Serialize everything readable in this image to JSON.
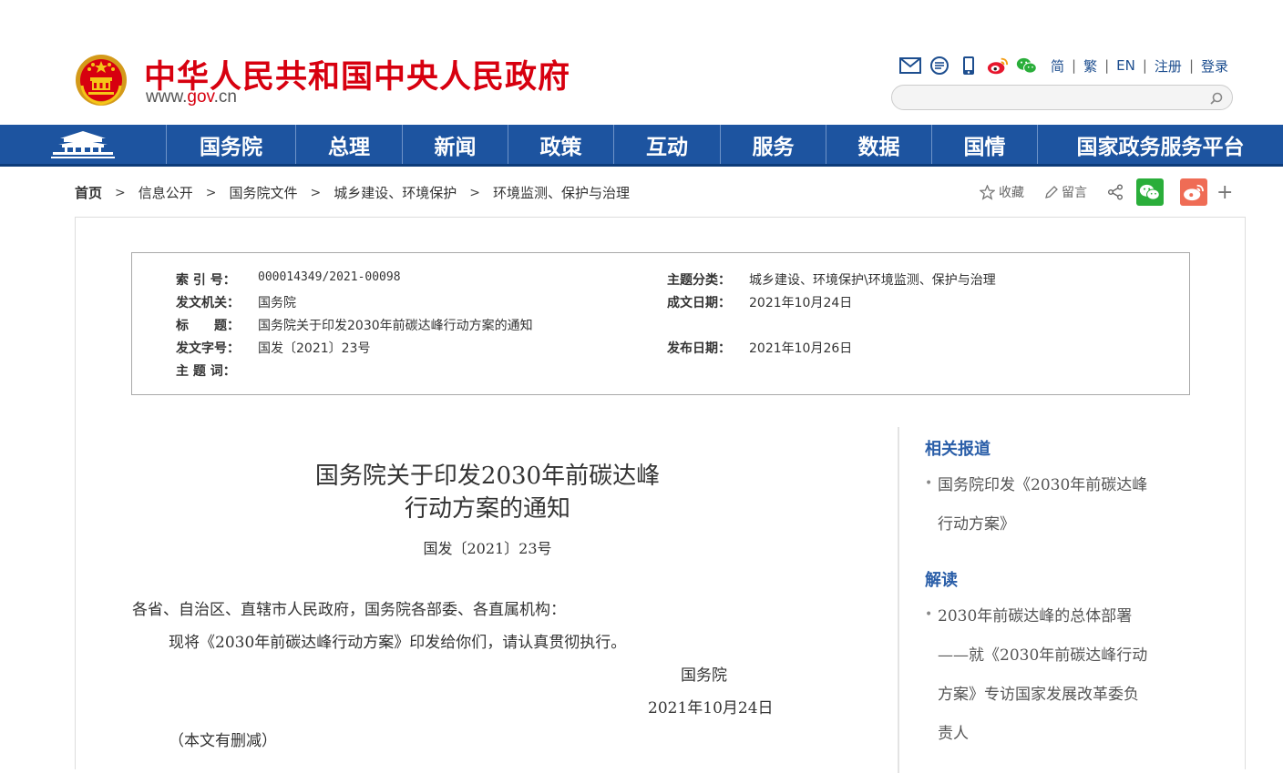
{
  "header": {
    "site_title": "中华人民共和国中央人民政府",
    "domain_prefix": "www.",
    "domain_mid": "gov",
    "domain_suffix": ".cn",
    "icons": [
      "mail-icon",
      "message-icon",
      "mobile-icon",
      "weibo-icon",
      "wechat-icon"
    ],
    "lang_links": [
      "简",
      "繁",
      "EN",
      "注册",
      "登录"
    ],
    "search_placeholder": ""
  },
  "nav": {
    "items": [
      "国务院",
      "总理",
      "新闻",
      "政策",
      "互动",
      "服务",
      "数据",
      "国情",
      "国家政务服务平台"
    ]
  },
  "breadcrumb": {
    "items": [
      "首页",
      "信息公开",
      "国务院文件",
      "城乡建设、环境保护",
      "环境监测、保护与治理"
    ]
  },
  "actions": {
    "favorite": "收藏",
    "comment": "留言",
    "share_icon": "share-icon",
    "more": "+"
  },
  "meta": {
    "index_label": "索 引 号：",
    "index_value": "000014349/2021-00098",
    "category_label": "主题分类：",
    "category_value": "城乡建设、环境保护\\环境监测、保护与治理",
    "issuer_label": "发文机关：",
    "issuer_value": "国务院",
    "written_label": "成文日期：",
    "written_value": "2021年10月24日",
    "title_label": "标　　题：",
    "title_value": "国务院关于印发2030年前碳达峰行动方案的通知",
    "docno_label": "发文字号：",
    "docno_value": "国发〔2021〕23号",
    "published_label": "发布日期：",
    "published_value": "2021年10月26日",
    "keywords_label": "主 题 词：",
    "keywords_value": ""
  },
  "document": {
    "title_line1": "国务院关于印发2030年前碳达峰",
    "title_line2": "行动方案的通知",
    "doc_number": "国发〔2021〕23号",
    "addressee": "各省、自治区、直辖市人民政府，国务院各部委、各直属机构：",
    "body": "现将《2030年前碳达峰行动方案》印发给你们，请认真贯彻执行。",
    "signer": "国务院",
    "date": "2021年10月24日",
    "note": "（本文有删减）"
  },
  "sidebar": {
    "related_heading": "相关报道",
    "related_items": [
      "国务院印发《2030年前碳达峰",
      "行动方案》"
    ],
    "interpret_heading": "解读",
    "interpret_lines": [
      "2030年前碳达峰的总体部署",
      "——就《2030年前碳达峰行动",
      "方案》专访国家发展改革委负",
      "责人"
    ]
  },
  "colors": {
    "brand_red": "#d7000f",
    "nav_blue": "#1d54a0",
    "link_blue": "#1d4e8f",
    "wechat_green": "#2aae3a",
    "weibo_orange": "#ef6c55"
  }
}
